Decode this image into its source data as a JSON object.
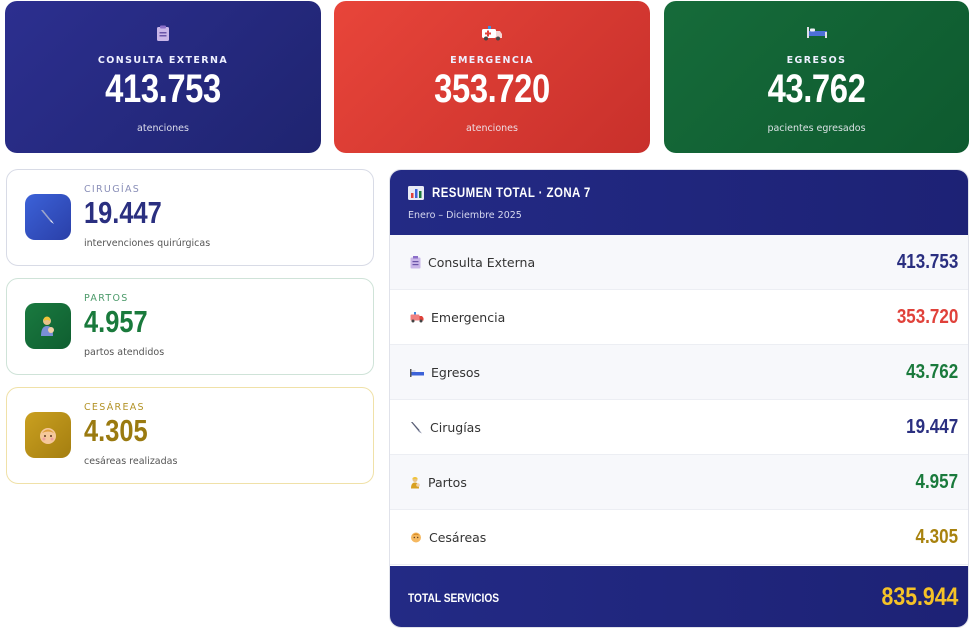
{
  "top_cards": [
    {
      "label": "CONSULTA EXTERNA",
      "value": "413.753",
      "sub": "atenciones",
      "icon": "clipboard-icon"
    },
    {
      "label": "EMERGENCIA",
      "value": "353.720",
      "sub": "atenciones",
      "icon": "ambulance-icon"
    },
    {
      "label": "EGRESOS",
      "value": "43.762",
      "sub": "pacientes egresados",
      "icon": "bed-icon"
    }
  ],
  "stats": [
    {
      "label": "CIRUGÍAS",
      "value": "19.447",
      "sub": "intervenciones quirúrgicas",
      "icon": "scalpel-icon"
    },
    {
      "label": "PARTOS",
      "value": "4.957",
      "sub": "partos atendidos",
      "icon": "mother-icon"
    },
    {
      "label": "CESÁREAS",
      "value": "4.305",
      "sub": "cesáreas realizadas",
      "icon": "baby-icon"
    }
  ],
  "summary": {
    "title": "RESUMEN TOTAL · ZONA 7",
    "subtitle": "Enero – Diciembre 2025",
    "rows": [
      {
        "label": "Consulta Externa",
        "value": "413.753",
        "color": "#2a2f80"
      },
      {
        "label": "Emergencia",
        "value": "353.720",
        "color": "#e0413a"
      },
      {
        "label": "Egresos",
        "value": "43.762",
        "color": "#1a7a3c"
      },
      {
        "label": "Cirugías",
        "value": "19.447",
        "color": "#2a2f80"
      },
      {
        "label": "Partos",
        "value": "4.957",
        "color": "#1a7a3c"
      },
      {
        "label": "Cesáreas",
        "value": "4.305",
        "color": "#a8820e"
      }
    ],
    "total_label": "TOTAL SERVICIOS",
    "total_value": "835.944"
  },
  "colors": {
    "blue": "#232a85",
    "red": "#e0413a",
    "green": "#166b3a",
    "gold": "#f5c227"
  }
}
